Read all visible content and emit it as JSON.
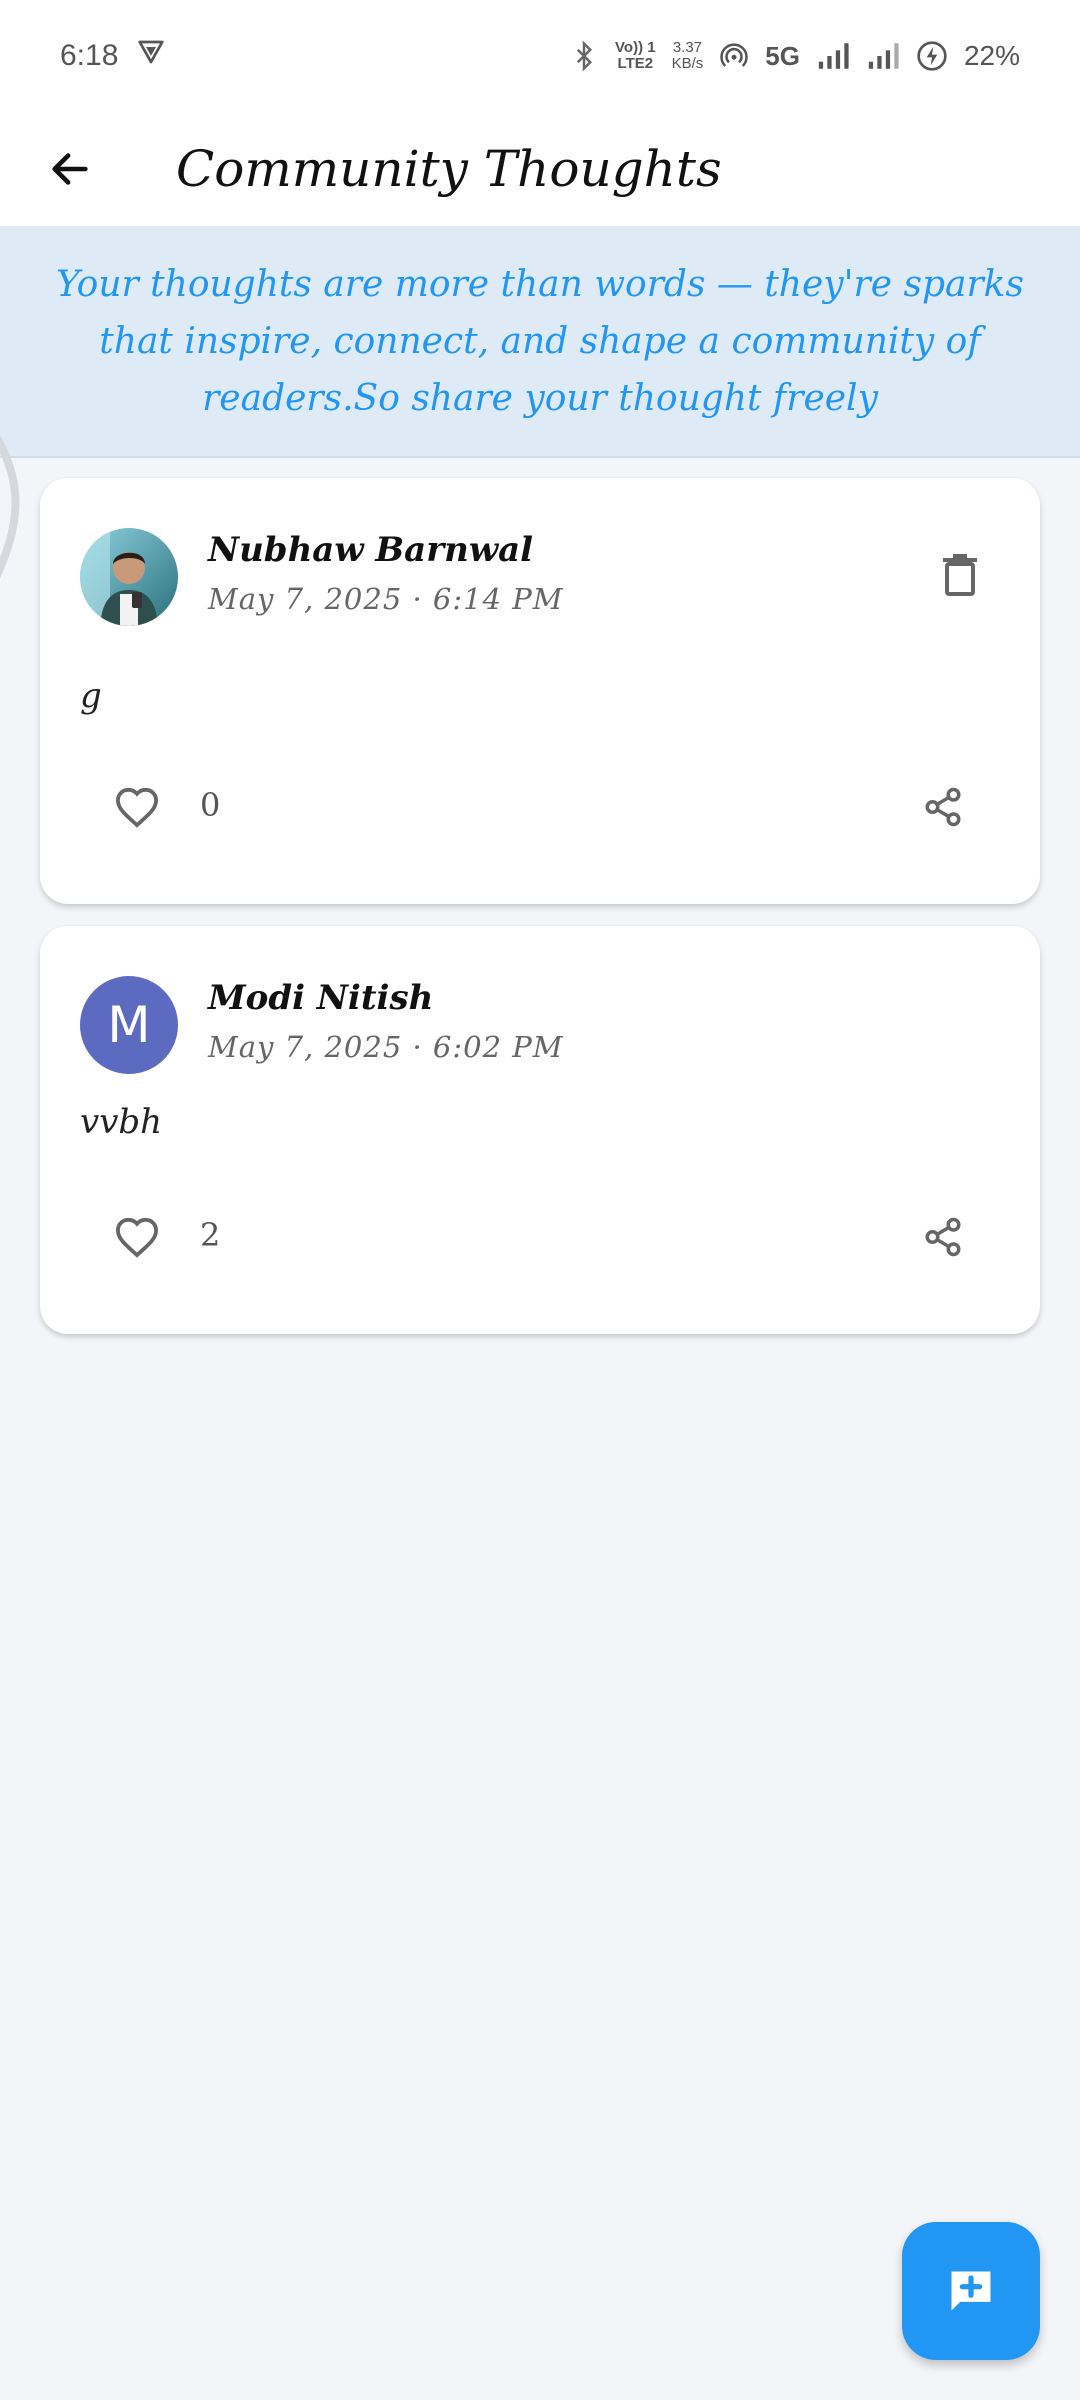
{
  "status_bar": {
    "time": "6:18",
    "network_top": "Vo)) 1",
    "network_bottom": "LTE2",
    "speed_top": "3.37",
    "speed_bottom": "KB/s",
    "network_type": "5G",
    "battery": "22%"
  },
  "app_bar": {
    "title": "Community Thoughts",
    "back_icon": "arrow-left-icon"
  },
  "banner": {
    "text": "Your thoughts are more than words — they're sparks that inspire, connect, and shape a community of readers.So share your thought freely"
  },
  "posts": [
    {
      "author": "Nubhaw Barnwal",
      "timestamp": "May 7, 2025 · 6:14 PM",
      "body": "g",
      "likes": "0",
      "avatar_type": "photo",
      "deletable": true
    },
    {
      "author": "Modi Nitish",
      "timestamp": "May 7, 2025 · 6:02 PM",
      "body": "vvbh",
      "likes": "2",
      "avatar_type": "letter",
      "avatar_letter": "M",
      "avatar_color": "#5c6bc0",
      "deletable": false
    }
  ],
  "fab": {
    "icon": "add-comment-icon",
    "color": "#2196f3"
  },
  "colors": {
    "accent": "#2196f3",
    "banner_bg": "#deebf7",
    "page_bg": "#f3f5f9"
  }
}
